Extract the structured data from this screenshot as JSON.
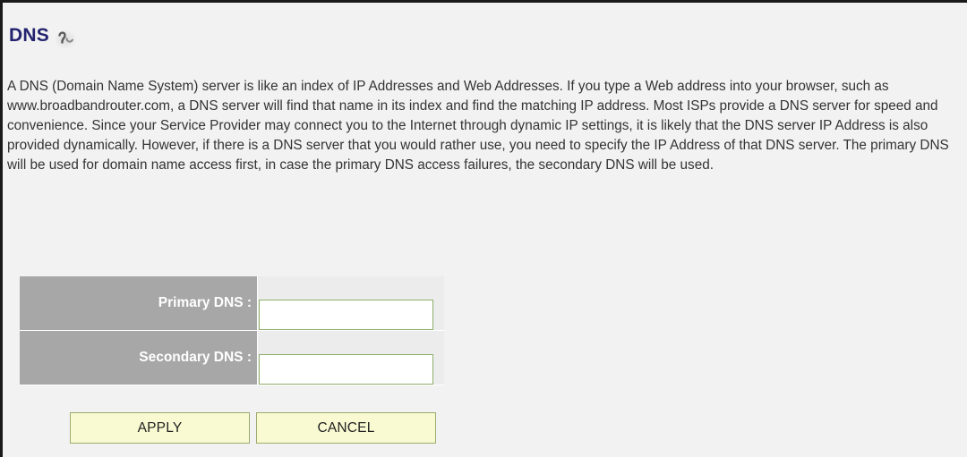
{
  "header": {
    "title": "DNS"
  },
  "help_icon": "help-question-icon",
  "description": "A DNS (Domain Name System) server is like an index of IP Addresses and Web Addresses. If you type a Web address into your browser, such as www.broadbandrouter.com, a DNS server will find that name in its index and find the matching IP address. Most ISPs provide a DNS server for speed and convenience. Since your Service Provider may connect you to the Internet through dynamic IP settings, it is likely that the DNS server IP Address is also provided dynamically. However, if there is a DNS server that you would rather use, you need to specify the IP Address of that DNS server. The primary DNS will be used for domain name access first, in case the primary DNS access failures, the secondary DNS will be used.",
  "form": {
    "primary_dns": {
      "label": "Primary DNS :",
      "value": ""
    },
    "secondary_dns": {
      "label": "Secondary DNS :",
      "value": ""
    }
  },
  "buttons": {
    "apply_label": "APPLY",
    "cancel_label": "CANCEL"
  },
  "colors": {
    "title": "#23236f",
    "panel_background": "#f2f2f2",
    "label_cell": "#a7a7a7",
    "button_background": "#fafad2",
    "input_border": "#8fae6b"
  }
}
